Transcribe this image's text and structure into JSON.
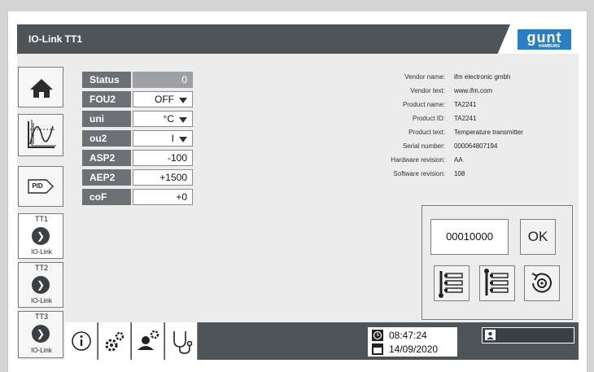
{
  "window": {
    "title": "IO-Link TT1"
  },
  "brand": {
    "logo_text": "gunt",
    "logo_sub": "HAMBURG"
  },
  "sidebar": {
    "items": [
      {
        "icon": "home-icon"
      },
      {
        "icon": "trend-chart-icon"
      },
      {
        "label": "PID"
      },
      {
        "top": "TT1",
        "bottom": "IO-Link",
        "active": true
      },
      {
        "top": "TT2",
        "bottom": "IO-Link"
      },
      {
        "top": "TT3",
        "bottom": "IO-Link"
      }
    ]
  },
  "params": [
    {
      "label": "Status",
      "value": "0"
    },
    {
      "label": "FOU2",
      "value": "OFF"
    },
    {
      "label": "uni",
      "value": "°C"
    },
    {
      "label": "ou2",
      "value": "I"
    },
    {
      "label": "ASP2",
      "value": "-100"
    },
    {
      "label": "AEP2",
      "value": "+1500"
    },
    {
      "label": "coF",
      "value": "+0"
    }
  ],
  "device_info": [
    {
      "key": "Vendor name:",
      "value": "ifm electronic gmbh"
    },
    {
      "key": "Vendor text:",
      "value": "www.ifm.com"
    },
    {
      "key": "Product name:",
      "value": "TA2241"
    },
    {
      "key": "Product ID:",
      "value": "TA2241"
    },
    {
      "key": "Product text:",
      "value": "Temperature transmitter"
    },
    {
      "key": "Serial number:",
      "value": "000064807194"
    },
    {
      "key": "Hardware revision:",
      "value": "AA"
    },
    {
      "key": "Software revision:",
      "value": "108"
    }
  ],
  "panel": {
    "code": "00010000",
    "ok_label": "OK"
  },
  "status": {
    "time": "08:47:24",
    "date": "14/09/2020"
  },
  "colors": {
    "titlebar": "#4f5459",
    "label_bg": "#6c7074",
    "accent": "#2a7fc2"
  }
}
